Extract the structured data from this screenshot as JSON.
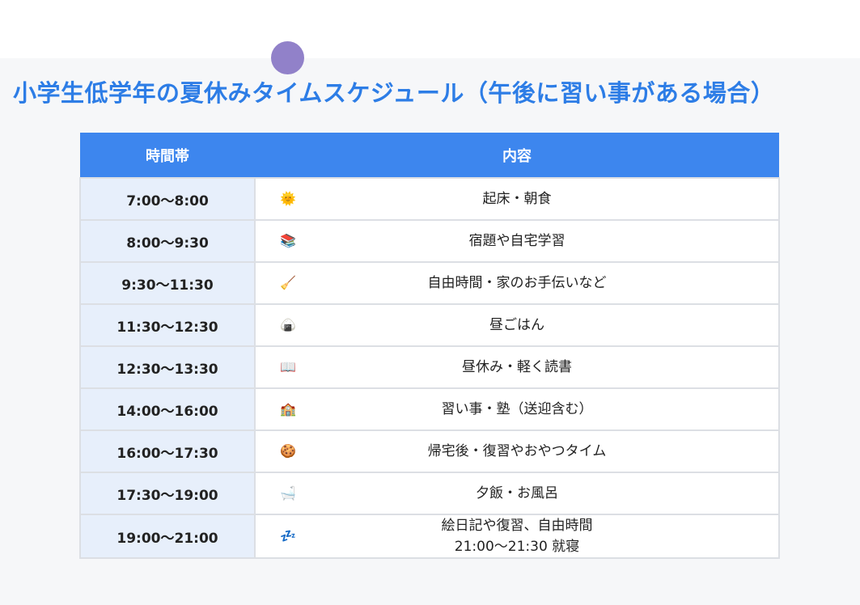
{
  "page": {
    "title": "小学生低学年の夏休みタイムスケジュール（午後に習い事がある場合）"
  },
  "table": {
    "headers": [
      "時間帯",
      "内容"
    ],
    "rows": [
      {
        "time": "7:00〜8:00",
        "icon": "sun-face-icon",
        "glyph": "🌞",
        "content": "起床・朝食"
      },
      {
        "time": "8:00〜9:30",
        "icon": "books-icon",
        "glyph": "📚",
        "content": "宿題や自宅学習"
      },
      {
        "time": "9:30〜11:30",
        "icon": "broom-icon",
        "glyph": "🧹",
        "content": "自由時間・家のお手伝いなど"
      },
      {
        "time": "11:30〜12:30",
        "icon": "rice-ball-icon",
        "glyph": "🍙",
        "content": "昼ごはん"
      },
      {
        "time": "12:30〜13:30",
        "icon": "open-book-icon",
        "glyph": "📖",
        "content": "昼休み・軽く読書"
      },
      {
        "time": "14:00〜16:00",
        "icon": "school-icon",
        "glyph": "🏫",
        "content": "習い事・塾（送迎含む）"
      },
      {
        "time": "16:00〜17:30",
        "icon": "cookie-icon",
        "glyph": "🍪",
        "content": "帰宅後・復習やおやつタイム"
      },
      {
        "time": "17:30〜19:00",
        "icon": "bathtub-icon",
        "glyph": "🛁",
        "content": "夕飯・お風呂"
      },
      {
        "time": "19:00〜21:00",
        "icon": "sleeping-zzz-icon",
        "glyph": "💤",
        "content": "絵日記や復習、自由時間\n21:00〜21:30 就寝"
      }
    ]
  },
  "colors": {
    "title": "#2d7de6",
    "header_bg": "#3d86ee",
    "time_cell_bg": "#e7effb",
    "decor_circle": "#9181c9"
  }
}
